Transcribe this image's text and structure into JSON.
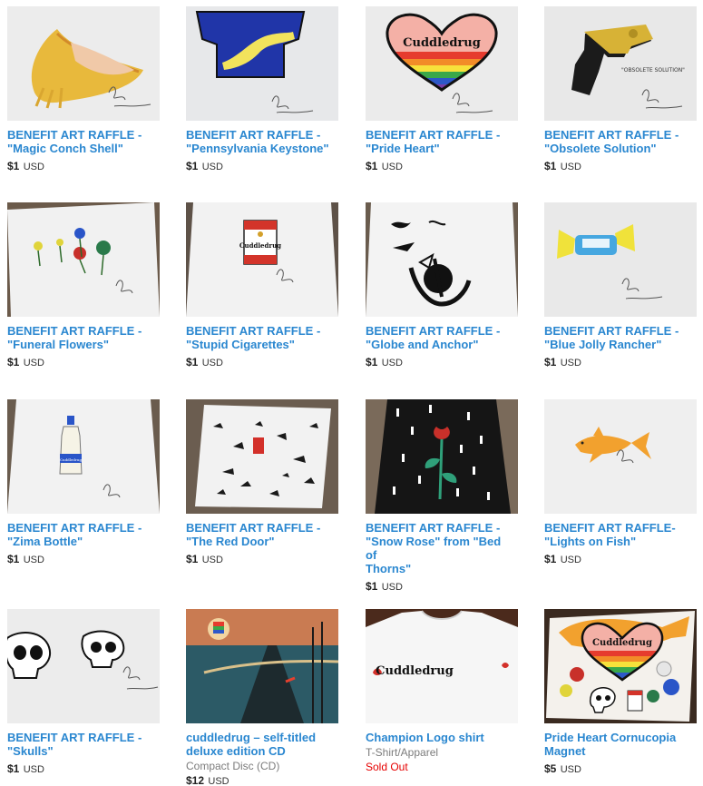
{
  "items": [
    {
      "id": "conch",
      "title_line1": "BENEFIT ART RAFFLE -",
      "title_line2": "\"Magic Conch Shell\"",
      "title_line3": "",
      "amount": "$1",
      "currency": "USD"
    },
    {
      "id": "keystone",
      "title_line1": "BENEFIT ART RAFFLE -",
      "title_line2": "\"Pennsylvania Keystone\"",
      "title_line3": "",
      "amount": "$1",
      "currency": "USD"
    },
    {
      "id": "pride-heart",
      "title_line1": "BENEFIT ART RAFFLE -",
      "title_line2": "\"Pride Heart\"",
      "title_line3": "",
      "amount": "$1",
      "currency": "USD"
    },
    {
      "id": "obsolete",
      "title_line1": "BENEFIT ART RAFFLE -",
      "title_line2": "\"Obsolete Solution\"",
      "title_line3": "",
      "amount": "$1",
      "currency": "USD"
    },
    {
      "id": "flowers",
      "title_line1": "BENEFIT ART RAFFLE -",
      "title_line2": "\"Funeral Flowers\"",
      "title_line3": "",
      "amount": "$1",
      "currency": "USD"
    },
    {
      "id": "cigarettes",
      "title_line1": "BENEFIT ART RAFFLE -",
      "title_line2": "\"Stupid Cigarettes\"",
      "title_line3": "",
      "amount": "$1",
      "currency": "USD"
    },
    {
      "id": "globe",
      "title_line1": "BENEFIT ART RAFFLE -",
      "title_line2": "\"Globe and Anchor\"",
      "title_line3": "",
      "amount": "$1",
      "currency": "USD"
    },
    {
      "id": "rancher",
      "title_line1": "BENEFIT ART RAFFLE -",
      "title_line2": "\"Blue Jolly Rancher\"",
      "title_line3": "",
      "amount": "$1",
      "currency": "USD"
    },
    {
      "id": "zima",
      "title_line1": "BENEFIT ART RAFFLE -",
      "title_line2": "\"Zima Bottle\"",
      "title_line3": "",
      "amount": "$1",
      "currency": "USD"
    },
    {
      "id": "red-door",
      "title_line1": "BENEFIT ART RAFFLE -",
      "title_line2": "\"The Red Door\"",
      "title_line3": "",
      "amount": "$1",
      "currency": "USD"
    },
    {
      "id": "snow-rose",
      "title_line1": "BENEFIT ART RAFFLE -",
      "title_line2": "\"Snow Rose\" from \"Bed of",
      "title_line3": "Thorns\"",
      "amount": "$1",
      "currency": "USD"
    },
    {
      "id": "fish",
      "title_line1": "BENEFIT ART RAFFLE-",
      "title_line2": "\"Lights on Fish\"",
      "title_line3": "",
      "amount": "$1",
      "currency": "USD"
    },
    {
      "id": "skulls",
      "title_line1": "BENEFIT ART RAFFLE -",
      "title_line2": "\"Skulls\"",
      "title_line3": "",
      "amount": "$1",
      "currency": "USD"
    },
    {
      "id": "cd",
      "title_line1": "cuddledrug – self-titled",
      "title_line2": "deluxe edition CD",
      "title_line3": "",
      "subtitle": "Compact Disc (CD)",
      "amount": "$12",
      "currency": "USD"
    },
    {
      "id": "shirt",
      "title_line1": "Champion Logo shirt",
      "title_line2": "",
      "title_line3": "",
      "subtitle": "T-Shirt/Apparel",
      "status": "Sold Out"
    },
    {
      "id": "magnet",
      "title_line1": "Pride Heart Cornucopia",
      "title_line2": "Magnet",
      "title_line3": "",
      "amount": "$5",
      "currency": "USD"
    }
  ],
  "art_text": {
    "heart_word": "Cuddledrug",
    "pack_word": "Cuddledrug",
    "bottle_word": "Cuddledrug",
    "obsolete_caption": "\"OBSOLETE SOLUTION\"",
    "shirt_word": "Cuddledrug",
    "magnet_word": "Cuddledrug"
  },
  "colors": {
    "link": "#2a87d0",
    "price": "#222222",
    "sold_out": "#e60000",
    "muted": "#7c7c7c"
  }
}
